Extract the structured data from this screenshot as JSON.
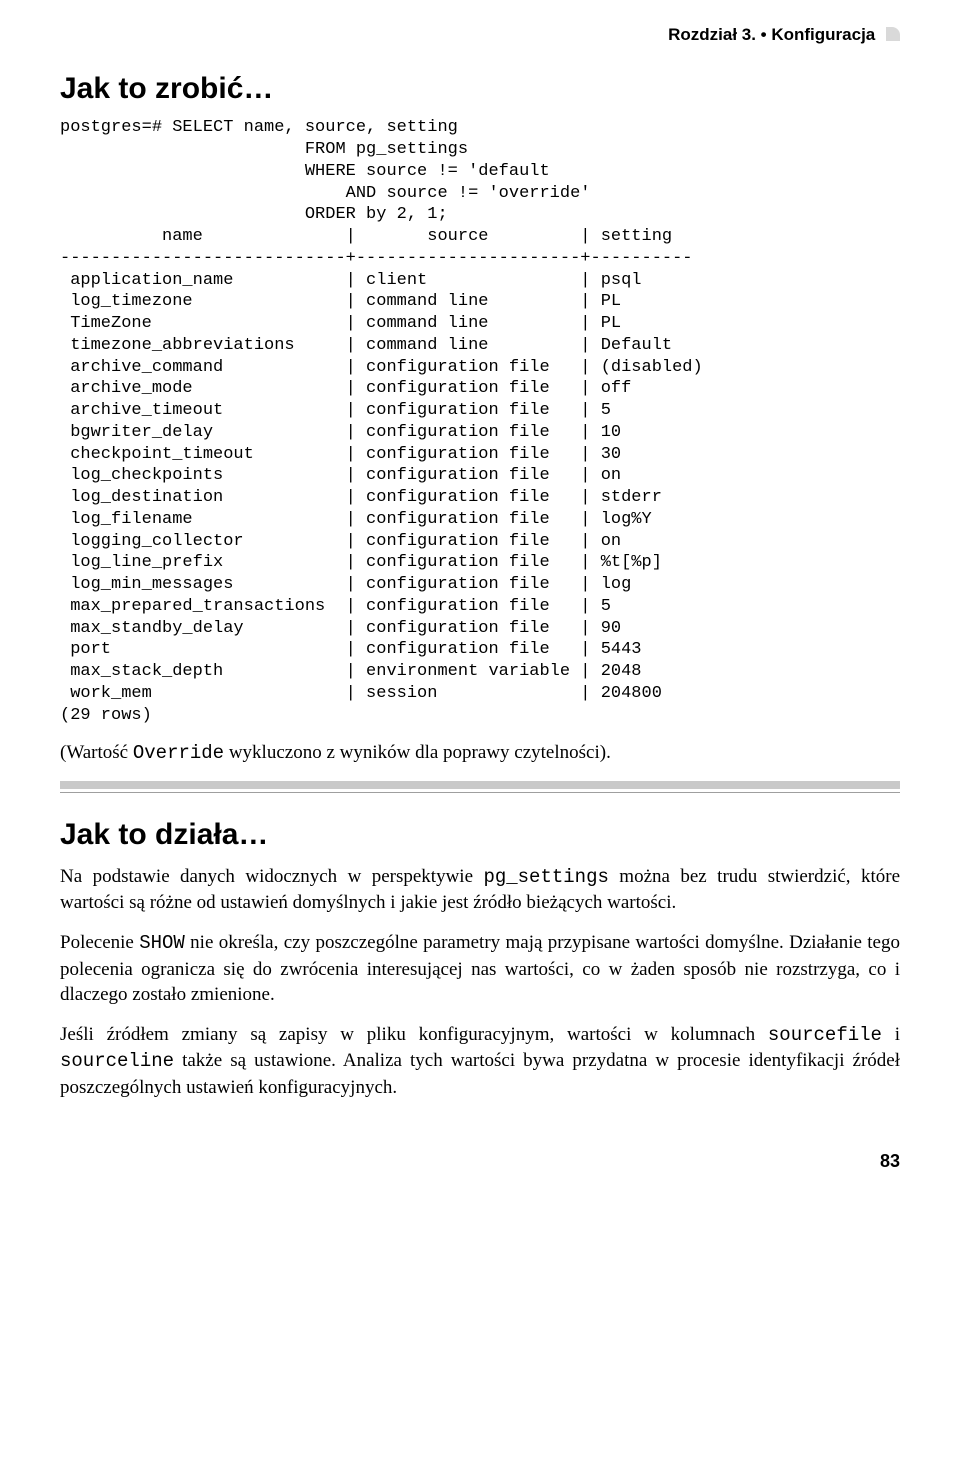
{
  "chapter_header": "Rozdział 3. • Konfiguracja",
  "section1_title": "Jak to zrobić…",
  "code_block": "postgres=# SELECT name, source, setting\n                        FROM pg_settings\n                        WHERE source != 'default\n                            AND source != 'override'\n                        ORDER by 2, 1;\n          name              |       source         | setting\n----------------------------+----------------------+----------\n application_name           | client               | psql\n log_timezone               | command line         | PL\n TimeZone                   | command line         | PL\n timezone_abbreviations     | command line         | Default\n archive_command            | configuration file   | (disabled)\n archive_mode               | configuration file   | off\n archive_timeout            | configuration file   | 5\n bgwriter_delay             | configuration file   | 10\n checkpoint_timeout         | configuration file   | 30\n log_checkpoints            | configuration file   | on\n log_destination            | configuration file   | stderr\n log_filename               | configuration file   | log%Y\n logging_collector          | configuration file   | on\n log_line_prefix            | configuration file   | %t[%p]\n log_min_messages           | configuration file   | log\n max_prepared_transactions  | configuration file   | 5\n max_standby_delay          | configuration file   | 90\n port                       | configuration file   | 5443\n max_stack_depth            | environment variable | 2048\n work_mem                   | session              | 204800\n(29 rows)",
  "override_note_pre": "(Wartość ",
  "override_note_mono": "Override",
  "override_note_post": " wykluczono z wyników dla poprawy czytelności).",
  "section2_title": "Jak to działa…",
  "para1_pre": "Na podstawie danych widocznych w perspektywie ",
  "para1_mono": "pg_settings",
  "para1_post": " można bez trudu stwierdzić, które wartości są różne od ustawień domyślnych i jakie jest źródło bieżących wartości.",
  "para2_pre": "Polecenie ",
  "para2_mono": "SHOW",
  "para2_post": " nie określa, czy poszczególne parametry mają przypisane wartości domyślne. Działanie tego polecenia ogranicza się do zwrócenia interesującej nas wartości, co w żaden sposób nie rozstrzyga, co i dlaczego zostało zmienione.",
  "para3_pre": "Jeśli źródłem zmiany są zapisy w pliku konfiguracyjnym, wartości w kolumnach ",
  "para3_mono1": "sourcefile",
  "para3_mid": " i ",
  "para3_mono2": "sourceline",
  "para3_post": " także są ustawione. Analiza tych wartości bywa przydatna w procesie identyfikacji źródeł poszczególnych ustawień konfiguracyjnych.",
  "pagenum": "83"
}
